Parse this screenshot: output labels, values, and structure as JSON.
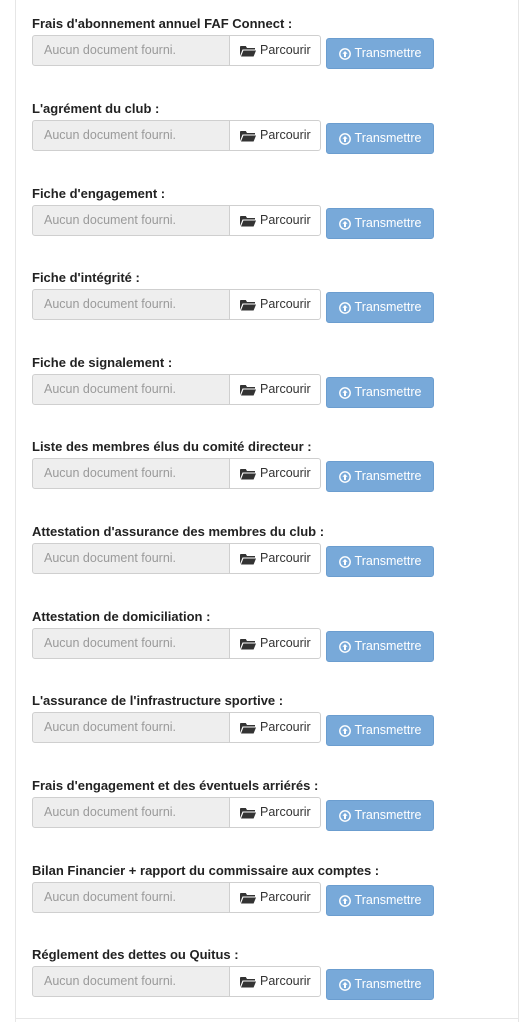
{
  "common": {
    "placeholder": "Aucun document fourni.",
    "browse_label": "Parcourir",
    "submit_label": "Transmettre",
    "browse_icon": "folder-open-icon",
    "submit_icon": "upload-circle-icon",
    "accent_color": "#78a9d9"
  },
  "documents": [
    {
      "label": "Frais d'abonnement annuel FAF Connect :"
    },
    {
      "label": "L'agrément du club :"
    },
    {
      "label": "Fiche d'engagement :"
    },
    {
      "label": "Fiche d'intégrité :"
    },
    {
      "label": "Fiche de signalement :"
    },
    {
      "label": "Liste des membres élus du comité directeur :"
    },
    {
      "label": "Attestation d'assurance des membres du club :"
    },
    {
      "label": "Attestation de domiciliation :"
    },
    {
      "label": "L'assurance de l'infrastructure sportive :"
    },
    {
      "label": "Frais d'engagement et des éventuels arriérés :"
    },
    {
      "label": "Bilan Financier + rapport du commissaire aux comptes :"
    },
    {
      "label": "Réglement des dettes ou Quitus :"
    }
  ]
}
